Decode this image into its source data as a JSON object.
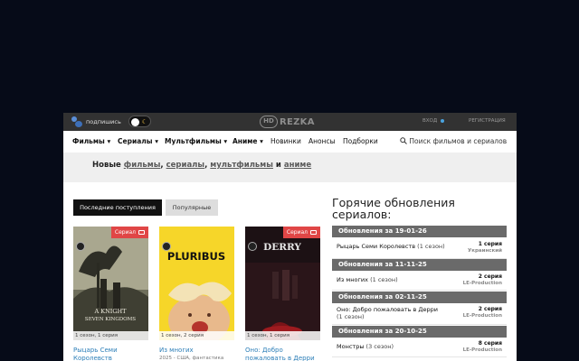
{
  "topbar": {
    "subscribe_label": "подпишись",
    "logo_badge": "HD",
    "logo_text": "REZKA",
    "login_label": "ВХОД",
    "register_label": "РЕГИСТРАЦИЯ"
  },
  "nav": {
    "items": [
      {
        "label": "Фильмы",
        "dropdown": true
      },
      {
        "label": "Сериалы",
        "dropdown": true
      },
      {
        "label": "Мультфильмы",
        "dropdown": true
      },
      {
        "label": "Аниме",
        "dropdown": true
      },
      {
        "label": "Новинки",
        "dropdown": false
      },
      {
        "label": "Анонсы",
        "dropdown": false
      },
      {
        "label": "Подборки",
        "dropdown": false
      }
    ],
    "search_placeholder": "Поиск фильмов и сериалов"
  },
  "banner": {
    "prefix": "Новые",
    "links": [
      "фильмы",
      "сериалы",
      "мультфильмы",
      "аниме"
    ],
    "sep_comma": ",",
    "sep_and": "и"
  },
  "tabs": {
    "latest": "Последние поступления",
    "popular": "Популярные"
  },
  "cards": [
    {
      "tag": "Сериал",
      "episode": "1 сезон, 1 серия",
      "title": "Рыцарь Семи Королевств",
      "meta": ""
    },
    {
      "tag": "",
      "episode": "1 сезон, 2 серия",
      "title": "Из многих",
      "meta": "2025 - США, фантастика",
      "poster_text": "PLURIBUS"
    },
    {
      "tag": "Сериал",
      "episode": "1 сезон, 1 серия",
      "title": "Оно: Добро пожаловать в Дерри",
      "meta": "",
      "poster_text": "DERRY"
    }
  ],
  "updates": {
    "title": "Горячие обновления сериалов:",
    "groups": [
      {
        "date_label": "Обновления за 19-01-26",
        "rows": [
          {
            "title": "Рыцарь Семи Королевств",
            "season": "(1 сезон)",
            "episode": "1 серия",
            "studio": "Украинский"
          }
        ]
      },
      {
        "date_label": "Обновления за 11-11-25",
        "rows": [
          {
            "title": "Из многих",
            "season": "(1 сезон)",
            "episode": "2 серия",
            "studio": "LE-Production"
          }
        ]
      },
      {
        "date_label": "Обновления за 02-11-25",
        "rows": [
          {
            "title": "Оно: Добро пожаловать в Дерри",
            "season": "(1 сезон)",
            "episode": "2 серия",
            "studio": "LE-Production"
          }
        ]
      },
      {
        "date_label": "Обновления за 20-10-25",
        "rows": [
          {
            "title": "Монстры",
            "season": "(3 сезон)",
            "episode": "8 серия",
            "studio": "LE-Production"
          }
        ]
      }
    ]
  },
  "colors": {
    "page_bg": "#060b18",
    "topbar_bg": "#323232",
    "tag_red": "#e04646",
    "link_blue": "#2d7fb8",
    "group_header": "#6a6a6a"
  }
}
